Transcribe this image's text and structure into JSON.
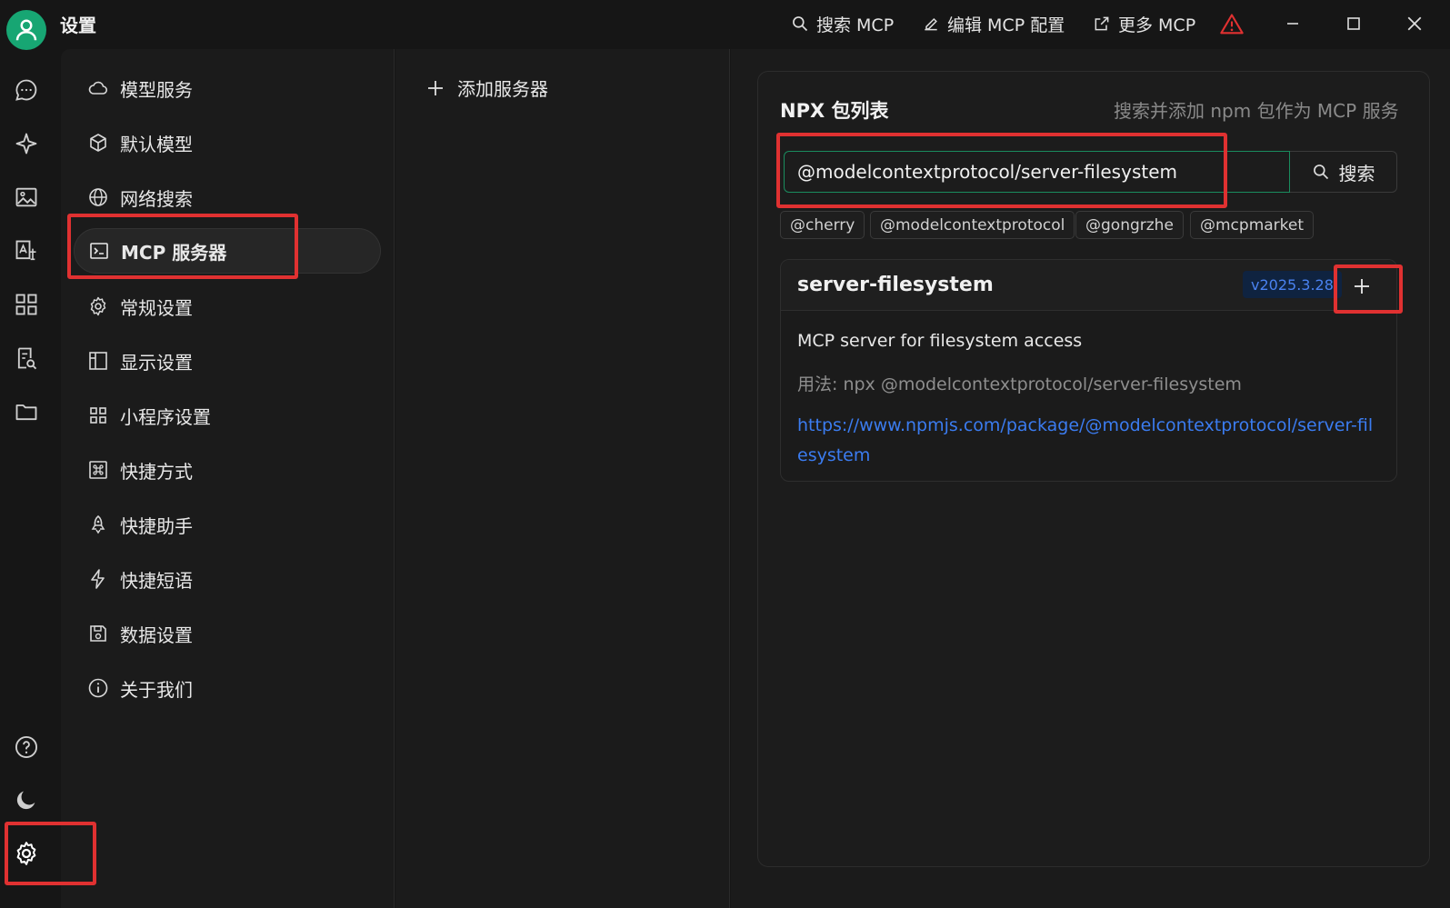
{
  "app": {
    "title": "设置"
  },
  "toolbar": {
    "search_mcp": "搜索 MCP",
    "edit_mcp": "编辑 MCP 配置",
    "more_mcp": "更多 MCP"
  },
  "rail": {
    "icons": [
      "chat-icon",
      "sparkle-icon",
      "image-icon",
      "translate-icon",
      "apps-icon",
      "file-search-icon",
      "folder-icon",
      "help-icon",
      "moon-icon",
      "settings-icon"
    ]
  },
  "nav": {
    "items": [
      {
        "label": "模型服务",
        "icon": "cloud-icon"
      },
      {
        "label": "默认模型",
        "icon": "cube-icon"
      },
      {
        "label": "网络搜索",
        "icon": "globe-icon"
      },
      {
        "label": "MCP 服务器",
        "icon": "terminal-icon",
        "active": true
      },
      {
        "label": "常规设置",
        "icon": "gear-icon"
      },
      {
        "label": "显示设置",
        "icon": "layout-icon"
      },
      {
        "label": "小程序设置",
        "icon": "grid-icon"
      },
      {
        "label": "快捷方式",
        "icon": "command-icon"
      },
      {
        "label": "快捷助手",
        "icon": "rocket-icon"
      },
      {
        "label": "快捷短语",
        "icon": "zap-icon"
      },
      {
        "label": "数据设置",
        "icon": "save-icon"
      },
      {
        "label": "关于我们",
        "icon": "info-icon"
      }
    ]
  },
  "servers": {
    "add_label": "添加服务器"
  },
  "npx": {
    "title": "NPX 包列表",
    "description": "搜索并添加 npm 包作为 MCP 服务",
    "search_value": "@modelcontextprotocol/server-filesystem",
    "search_button": "搜索",
    "tags": [
      "@cherry",
      "@modelcontextprotocol",
      "@gongrzhe",
      "@mcpmarket"
    ],
    "package": {
      "name": "server-filesystem",
      "version": "v2025.3.28",
      "summary": "MCP server for filesystem access",
      "usage": "用法: npx @modelcontextprotocol/server-filesystem",
      "link": "https://www.npmjs.com/package/@modelcontextprotocol/server-filesystem"
    }
  },
  "colors": {
    "accent": "#17a673",
    "link": "#3b7cf0",
    "highlight": "#e03131",
    "warning": "#e03131"
  }
}
